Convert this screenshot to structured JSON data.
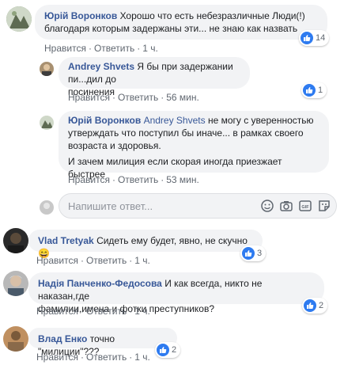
{
  "comments": [
    {
      "author": "Юрій Воронков",
      "text_lines": [
        "Хорошо что есть небезразличные Люди(!)",
        "благодаря которым задержаны эти... не знаю как назвать"
      ],
      "like": "Нравится",
      "reply": "Ответить",
      "time": "1 ч.",
      "reactions": "14"
    },
    {
      "author": "Andrey Shvets",
      "text_lines": [
        "Я бы при задержании пи...дил до",
        "посинения"
      ],
      "like": "Нравится",
      "reply": "Ответить",
      "time": "56 мин.",
      "reactions": "1"
    },
    {
      "author": "Юрій Воронков",
      "mention": "Andrey Shvets",
      "text_lines": [
        "не могу с уверенностью",
        "утверждать что поступил бы иначе... в рамках своего",
        "возраста и здоровья."
      ],
      "text_extra": "И зачем милиция если скорая иногда приезжает быстрее",
      "like": "Нравится",
      "reply": "Ответить",
      "time": "53 мин."
    },
    {
      "author": "Vlad Tretyak",
      "text_lines": [
        "Сидеть ему будет, явно, не скучно"
      ],
      "emoji": "😄",
      "like": "Нравится",
      "reply": "Ответить",
      "time": "1 ч.",
      "reactions": "3"
    },
    {
      "author": "Надія Панченко-Федосова",
      "text_lines": [
        "И как всегда, никто не наказан,где",
        "фамилии,имена и фотки преступников?"
      ],
      "like": "Нравится",
      "reply": "Ответить",
      "time": "1 ч.",
      "reactions": "2"
    },
    {
      "author": "Влад Енко",
      "text_lines": [
        "точно \"милиции\"???"
      ],
      "like": "Нравится",
      "reply": "Ответить",
      "time": "1 ч.",
      "reactions": "2"
    }
  ],
  "reply_input": {
    "placeholder": "Напишите ответ..."
  },
  "dot": "·",
  "colors": {
    "author": "#385898",
    "bubble": "#f2f3f5",
    "like_blue": "#2e7bf0"
  },
  "icons": [
    "emoji-icon",
    "camera-icon",
    "gif-icon",
    "sticker-icon",
    "like-icon"
  ]
}
